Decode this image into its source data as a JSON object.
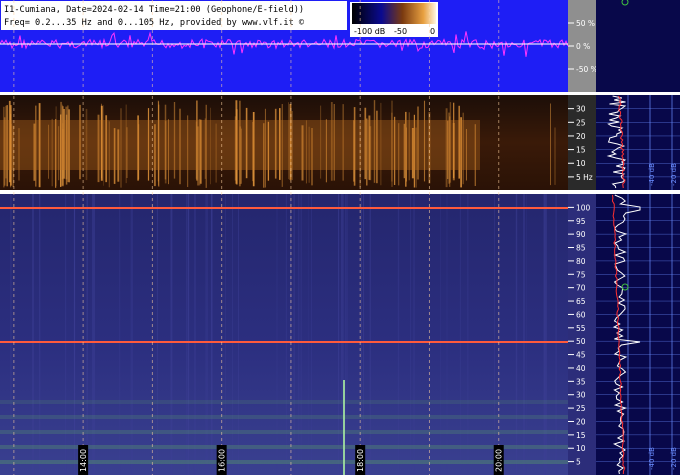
{
  "header": {
    "line1": "I1-Cumiana, Date=2024-02-14 Time=21:00 (Geophone/E-field))",
    "line2": "Freq= 0.2...35 Hz and 0...105 Hz, provided by www.vlf.it ©"
  },
  "colorbar": {
    "tick_labels": [
      "-100 dB",
      "-50",
      "0"
    ]
  },
  "colors": {
    "waveform_bg": "#1e1ef5",
    "waveform_trace": "#ff33ff",
    "spectro_low_bg": "#2b1406",
    "spectro_low_line": "#f0a040",
    "spectro_high_bg": "#2c2d7a",
    "marker_line": "#ff5a3c",
    "side_panel_bg": "#08084a",
    "grid_line": "#6a8cff",
    "side_trace": "#ffffff",
    "side_red": "#ff3030",
    "ruler_bg": "#8f8f8f"
  },
  "chart_data": [
    {
      "type": "line",
      "panel": "waveform",
      "y_unit": "%",
      "ylim": [
        -100,
        100
      ],
      "y_ticks": [
        {
          "value": 50,
          "label": "50 %"
        },
        {
          "value": 0,
          "label": "0 %"
        },
        {
          "value": -50,
          "label": "-50 %"
        }
      ]
    },
    {
      "type": "heatmap",
      "panel": "spectrogram-low",
      "y_unit": "Hz",
      "ylim": [
        0.2,
        35
      ],
      "y_ticks": [
        {
          "value": 30,
          "label": "30"
        },
        {
          "value": 25,
          "label": "25"
        },
        {
          "value": 20,
          "label": "20"
        },
        {
          "value": 15,
          "label": "15"
        },
        {
          "value": 10,
          "label": "10"
        },
        {
          "value": 5,
          "label": "5 Hz"
        }
      ]
    },
    {
      "type": "heatmap",
      "panel": "spectrogram-high",
      "y_unit": "Hz",
      "ylim": [
        0,
        105
      ],
      "y_ticks": [
        {
          "value": 100,
          "label": "100"
        },
        {
          "value": 95,
          "label": "95"
        },
        {
          "value": 90,
          "label": "90"
        },
        {
          "value": 85,
          "label": "85"
        },
        {
          "value": 80,
          "label": "80"
        },
        {
          "value": 75,
          "label": "75"
        },
        {
          "value": 70,
          "label": "70"
        },
        {
          "value": 65,
          "label": "65"
        },
        {
          "value": 60,
          "label": "60"
        },
        {
          "value": 55,
          "label": "55"
        },
        {
          "value": 50,
          "label": "50"
        },
        {
          "value": 45,
          "label": "45"
        },
        {
          "value": 40,
          "label": "40"
        },
        {
          "value": 35,
          "label": "35"
        },
        {
          "value": 30,
          "label": "30"
        },
        {
          "value": 25,
          "label": "25"
        },
        {
          "value": 20,
          "label": "20"
        },
        {
          "value": 15,
          "label": "15"
        },
        {
          "value": 10,
          "label": "10"
        },
        {
          "value": 5,
          "label": "5"
        }
      ],
      "persistent_lines_hz": [
        100,
        50
      ]
    },
    {
      "type": "line",
      "panel": "time-axis",
      "x_range_hours": [
        12.8,
        21.0
      ],
      "x_ticks": [
        {
          "value": 14,
          "label": "14:00"
        },
        {
          "value": 16,
          "label": "16:00"
        },
        {
          "value": 18,
          "label": "18:00"
        },
        {
          "value": 20,
          "label": "20:00"
        }
      ],
      "x_gridlines": [
        13,
        14,
        15,
        16,
        17,
        18,
        19,
        20
      ]
    },
    {
      "type": "line",
      "panel": "average-spectrum",
      "x_unit": "dB",
      "x_ticks": [
        {
          "value": -40,
          "label": "-40 dB"
        },
        {
          "value": -20,
          "label": "-20 dB"
        }
      ]
    }
  ]
}
